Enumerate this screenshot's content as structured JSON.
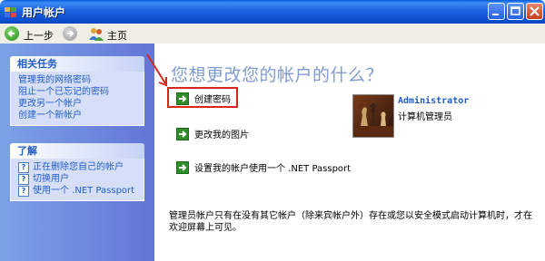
{
  "window": {
    "title": "用户帐户"
  },
  "toolbar": {
    "back_label": "上一步",
    "home_label": "主页"
  },
  "sidebar": {
    "related_tasks": {
      "header": "相关任务",
      "links": [
        "管理我的网络密码",
        "阻止一个已忘记的密码",
        "更改另一个帐户",
        "创建一个新帐户"
      ]
    },
    "learn": {
      "header": "了解",
      "links": [
        "正在删除您自己的帐户",
        "切换用户",
        "使用一个 .NET Passport"
      ]
    }
  },
  "main": {
    "heading": "您想更改您的帐户的什么？",
    "tasks": [
      "创建密码",
      "更改我的图片",
      "设置我的帐户使用一个 .NET Passport"
    ],
    "account": {
      "name": "Administrator",
      "role": "计算机管理员"
    },
    "notice": "管理员帐户只有在没有其它帐户（除来宾帐户外）存在或您以安全模式启动计算机时，才在欢迎屏幕上可见。"
  },
  "colors": {
    "title_bar": "#0a5bdc",
    "sidebar": "#6f8fe0",
    "link": "#215dc6",
    "highlight": "#d9261c",
    "task_arrow": "#2f8d2a"
  },
  "icons": {
    "back": "back-arrow-icon",
    "forward": "forward-arrow-icon",
    "home": "users-icon",
    "task": "green-arrow-icon",
    "learn": "help-icon"
  }
}
